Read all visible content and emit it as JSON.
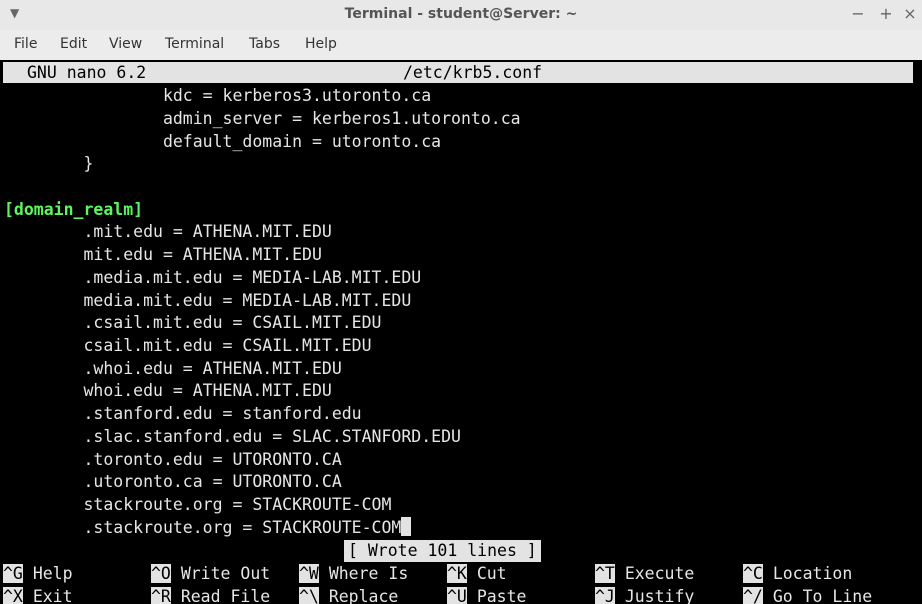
{
  "window": {
    "title": "Terminal - student@Server: ~"
  },
  "menu": [
    "File",
    "Edit",
    "View",
    "Terminal",
    "Tabs",
    "Help"
  ],
  "nano": {
    "version": "GNU nano 6.2",
    "filename": "/etc/krb5.conf",
    "lines": [
      "                kdc = kerberos3.utoronto.ca",
      "                admin_server = kerberos1.utoronto.ca",
      "                default_domain = utoronto.ca",
      "        }",
      "",
      "[domain_realm]",
      "        .mit.edu = ATHENA.MIT.EDU",
      "        mit.edu = ATHENA.MIT.EDU",
      "        .media.mit.edu = MEDIA-LAB.MIT.EDU",
      "        media.mit.edu = MEDIA-LAB.MIT.EDU",
      "        .csail.mit.edu = CSAIL.MIT.EDU",
      "        csail.mit.edu = CSAIL.MIT.EDU",
      "        .whoi.edu = ATHENA.MIT.EDU",
      "        whoi.edu = ATHENA.MIT.EDU",
      "        .stanford.edu = stanford.edu",
      "        .slac.stanford.edu = SLAC.STANFORD.EDU",
      "        .toronto.edu = UTORONTO.CA",
      "        .utoronto.ca = UTORONTO.CA",
      "        stackroute.org = STACKROUTE-COM",
      "        .stackroute.org = STACKROUTE-COM"
    ],
    "status": "[ Wrote 101 lines ]",
    "shortcuts": [
      {
        "key": "^G",
        "label": "Help"
      },
      {
        "key": "^O",
        "label": "Write Out"
      },
      {
        "key": "^W",
        "label": "Where Is"
      },
      {
        "key": "^K",
        "label": "Cut"
      },
      {
        "key": "^T",
        "label": "Execute"
      },
      {
        "key": "^C",
        "label": "Location"
      },
      {
        "key": "^X",
        "label": "Exit"
      },
      {
        "key": "^R",
        "label": "Read File"
      },
      {
        "key": "^\\",
        "label": "Replace"
      },
      {
        "key": "^U",
        "label": "Paste"
      },
      {
        "key": "^J",
        "label": "Justify"
      },
      {
        "key": "^/",
        "label": "Go To Line"
      }
    ]
  }
}
